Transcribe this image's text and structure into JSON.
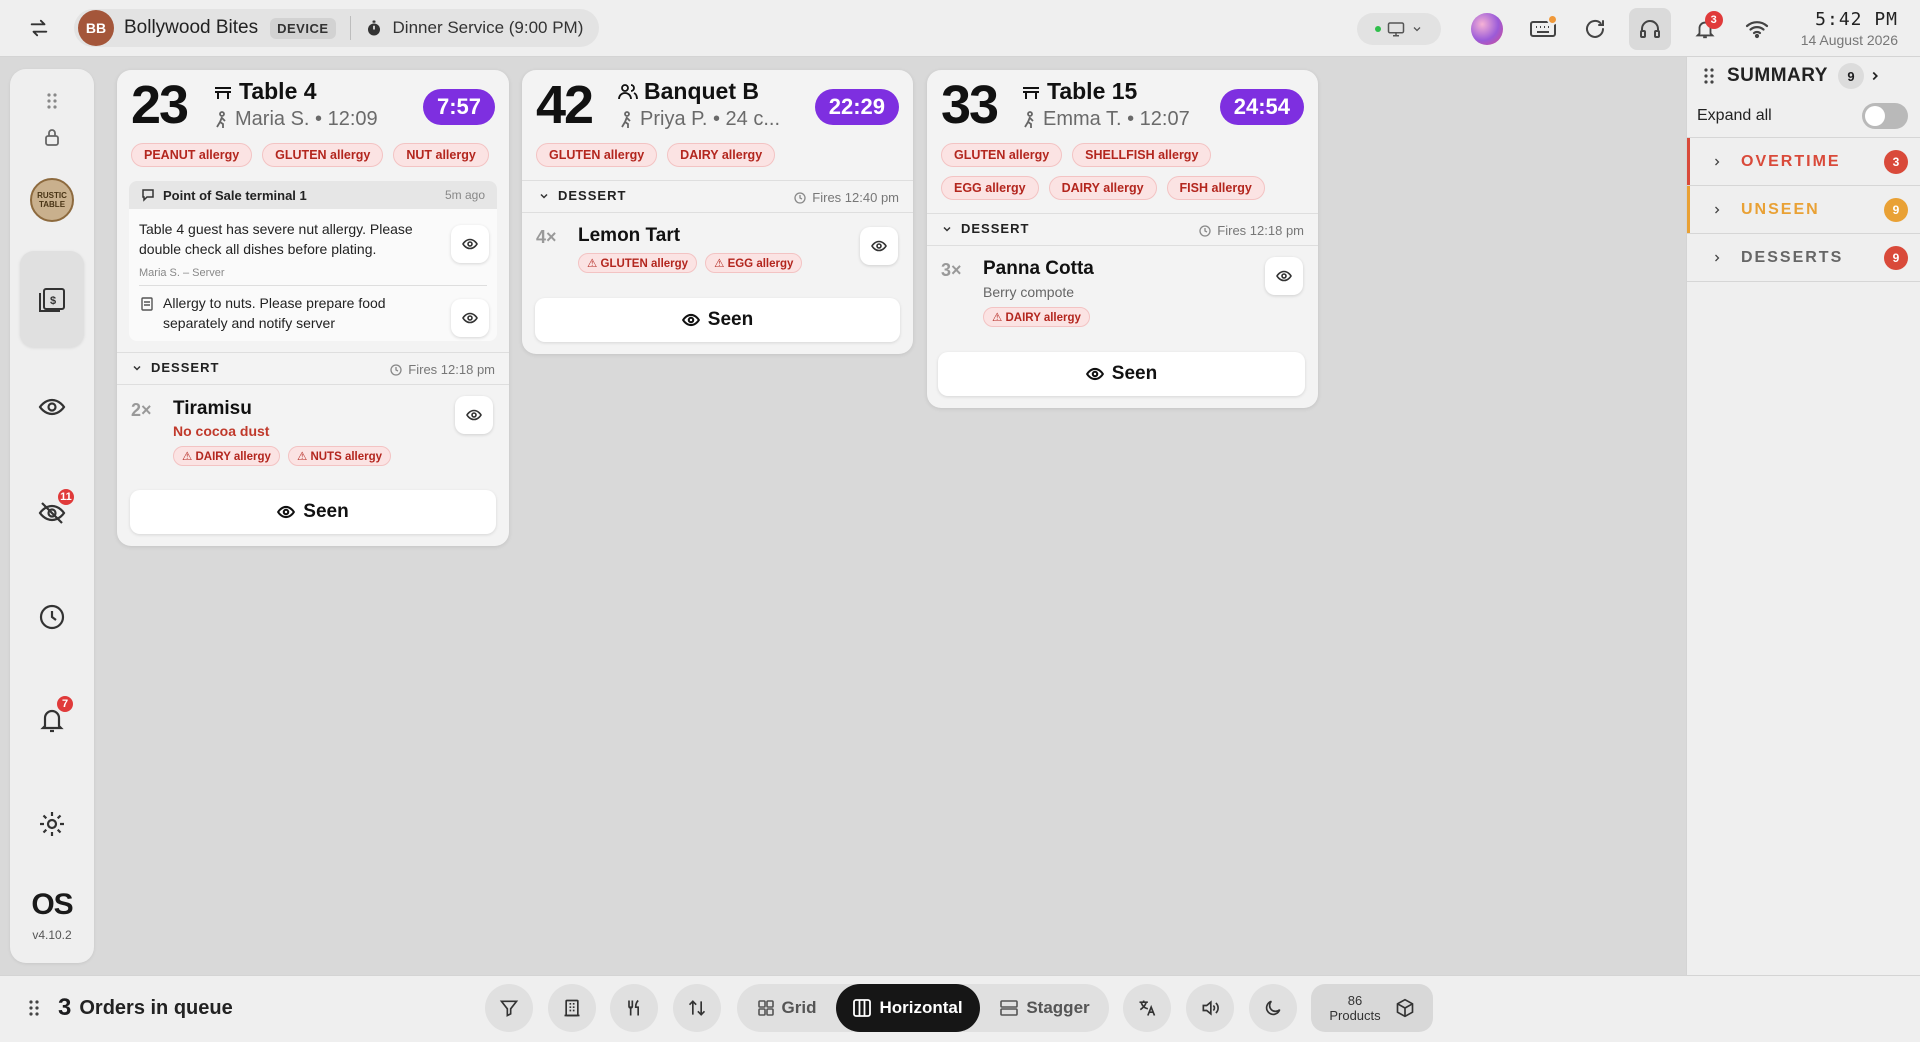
{
  "topbar": {
    "avatar_initials": "BB",
    "venue_name": "Bollywood Bites",
    "device_tag": "DEVICE",
    "service_label": "Dinner Service (9:00 PM)",
    "notifications_count": "3",
    "time": "5:42 PM",
    "date": "14 August 2026"
  },
  "sidebar": {
    "logo_text": "RUSTIC TABLE",
    "unseen_badge": "11",
    "alerts_badge": "7",
    "os_logo": "OS",
    "version": "v4.10.2"
  },
  "orders": [
    {
      "number": "23",
      "title": "Table 4",
      "subtitle": "Maria S. • 12:09",
      "timer": "7:57",
      "allergies": [
        "PEANUT allergy",
        "GLUTEN allergy",
        "NUT allergy"
      ],
      "notes_header": "Point of Sale terminal 1",
      "notes_ago": "5m ago",
      "note1": "Table 4 guest has severe nut allergy. Please double check all dishes before plating.",
      "note1_meta": "Maria S. – Server",
      "note2": "Allergy to nuts. Please prepare food separately and notify server",
      "section": "DESSERT",
      "fires": "Fires 12:18 pm",
      "item_qty": "2×",
      "item_name": "Tiramisu",
      "item_mod": "No cocoa dust",
      "item_allergies": [
        "⚠ DAIRY allergy",
        "⚠ NUTS allergy"
      ],
      "seen_label": "Seen"
    },
    {
      "number": "42",
      "title": "Banquet B",
      "subtitle": "Priya P. • 24 c...",
      "timer": "22:29",
      "allergies": [
        "GLUTEN allergy",
        "DAIRY allergy"
      ],
      "section": "DESSERT",
      "fires": "Fires 12:40 pm",
      "item_qty": "4×",
      "item_name": "Lemon Tart",
      "item_allergies": [
        "⚠ GLUTEN allergy",
        "⚠ EGG allergy"
      ],
      "seen_label": "Seen"
    },
    {
      "number": "33",
      "title": "Table 15",
      "subtitle": "Emma T. • 12:07",
      "timer": "24:54",
      "allergies": [
        "GLUTEN allergy",
        "SHELLFISH allergy",
        "EGG allergy",
        "DAIRY allergy",
        "FISH allergy"
      ],
      "section": "DESSERT",
      "fires": "Fires 12:18 pm",
      "item_qty": "3×",
      "item_name": "Panna Cotta",
      "item_sub": "Berry compote",
      "item_allergies": [
        "⚠ DAIRY allergy"
      ],
      "seen_label": "Seen"
    }
  ],
  "summary": {
    "title": "SUMMARY",
    "count": "9",
    "expand_label": "Expand all",
    "rows": [
      {
        "label": "OVERTIME",
        "count": "3",
        "color": "#d94a3a"
      },
      {
        "label": "UNSEEN",
        "count": "9",
        "color": "#e9a135"
      },
      {
        "label": "DESSERTS",
        "count": "9",
        "color": "#d94a3a"
      }
    ]
  },
  "bottombar": {
    "queue_count": "3",
    "queue_label": "Orders in queue",
    "views": [
      "Grid",
      "Horizontal",
      "Stagger"
    ],
    "active_view": "Horizontal",
    "products_count": "86",
    "products_label": "Products"
  },
  "colors": {
    "timer_purple": "#7e2fe0",
    "allergy_red": "#b3261e",
    "overtime": "#d94a3a",
    "unseen": "#e9a135"
  }
}
